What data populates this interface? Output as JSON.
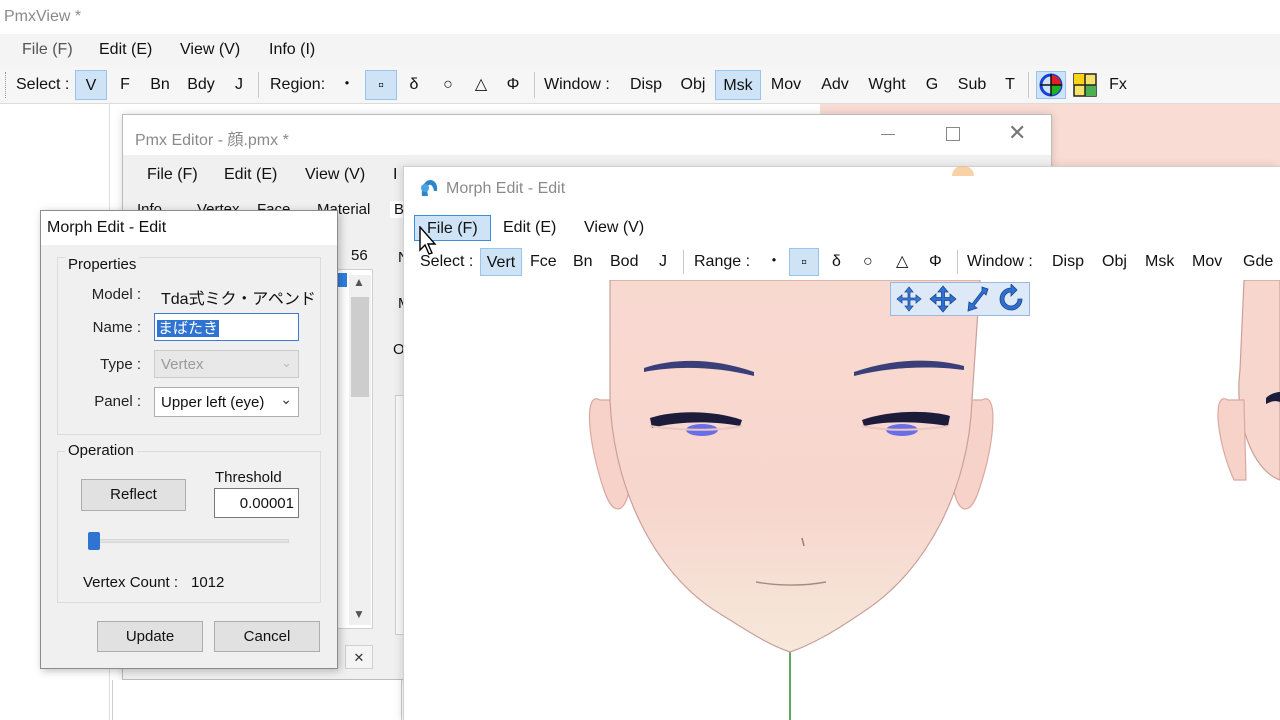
{
  "main_window": {
    "title": "PmxView *",
    "menu": [
      "File (F)",
      "Edit (E)",
      "View (V)",
      "Info (I)"
    ],
    "toolbar": {
      "select_label": "Select :",
      "select_items": [
        "V",
        "F",
        "Bn",
        "Bdy",
        "J"
      ],
      "region_label": "Region:",
      "region_items": [
        "・",
        "▫",
        "δ",
        "○",
        "△",
        "Φ"
      ],
      "window_label": "Window :",
      "window_items": [
        "Disp",
        "Obj",
        "Msk",
        "Mov",
        "Adv",
        "Wght",
        "G",
        "Sub",
        "T"
      ],
      "fx_label": "Fx"
    }
  },
  "pmx_editor": {
    "title": "Pmx Editor - 顔.pmx *",
    "menu": [
      "File (F)",
      "Edit (E)",
      "View (V)",
      "I"
    ],
    "tabs": [
      "Info",
      "Vertex",
      "Face",
      "Material",
      "Bo"
    ],
    "list_count": "56",
    "side_letters": [
      "N",
      "M",
      "O"
    ]
  },
  "morph_window": {
    "title": "Morph Edit - Edit",
    "menu": [
      "File (F)",
      "Edit (E)",
      "View (V)"
    ],
    "toolbar": {
      "select_label": "Select :",
      "select_items": [
        "Vert",
        "Fce",
        "Bn",
        "Bod",
        "J"
      ],
      "range_label": "Range :",
      "range_items": [
        "・",
        "▫",
        "δ",
        "○",
        "△",
        "Φ"
      ],
      "window_label": "Window :",
      "window_items": [
        "Disp",
        "Obj",
        "Msk",
        "Mov",
        "Gde"
      ]
    }
  },
  "dialog": {
    "title": "Morph Edit - Edit",
    "properties_label": "Properties",
    "model_label": "Model :",
    "model_value": "Tda式ミク・アペンド",
    "name_label": "Name :",
    "name_value": "まばたき",
    "type_label": "Type :",
    "type_value": "Vertex",
    "panel_label": "Panel :",
    "panel_value": "Upper left (eye)",
    "operation_label": "Operation",
    "reflect_label": "Reflect",
    "threshold_label": "Threshold",
    "threshold_value": "0.00001",
    "slider_value": 0.0,
    "vertex_count_label": "Vertex Count :",
    "vertex_count_value": "1012",
    "update_label": "Update",
    "cancel_label": "Cancel"
  },
  "colors": {
    "active_bg": "#cfe3f7",
    "skin": "#f9dcd4",
    "eyeline": "#1c1c3a",
    "iris": "#6a6ee6"
  }
}
